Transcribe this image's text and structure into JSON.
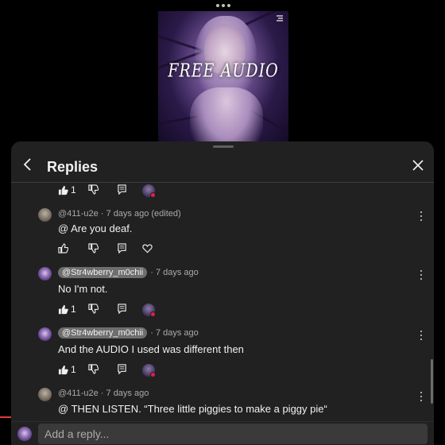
{
  "header": {
    "title": "Replies"
  },
  "comments": [
    {
      "author": "@411-u2e",
      "author_chip": false,
      "time": "· 7 days ago (edited)",
      "text": "@ Are you deaf.",
      "likes": ""
    },
    {
      "author": "@Str4wberry_m0chii",
      "author_chip": true,
      "time": "· 7 days ago",
      "text": "No I'm not.",
      "likes": "1"
    },
    {
      "author": "@Str4wberry_m0chii",
      "author_chip": true,
      "time": "· 7 days ago",
      "text": "And the AUDIO I used was different then",
      "likes": "1"
    },
    {
      "author": "@411-u2e",
      "author_chip": false,
      "time": "· 7 days ago",
      "text": "@ THEN LISTEN. “Three little piggies to make a piggy pie“",
      "likes": ""
    }
  ],
  "top_actions": {
    "likes": "1"
  },
  "video": {
    "caption": "FREE AUDIO"
  },
  "reply": {
    "placeholder": "Add a reply..."
  },
  "icons": {
    "like": "thumbs-up-icon",
    "dislike": "thumbs-down-icon",
    "reply": "comment-icon",
    "heart": "heart-icon",
    "more": "more-vertical-icon",
    "back": "chevron-left-icon",
    "close": "close-icon"
  },
  "colors": {
    "panel_bg": "#212121",
    "chip_bg": "#6e6e6e",
    "heart": "#e11d48"
  }
}
